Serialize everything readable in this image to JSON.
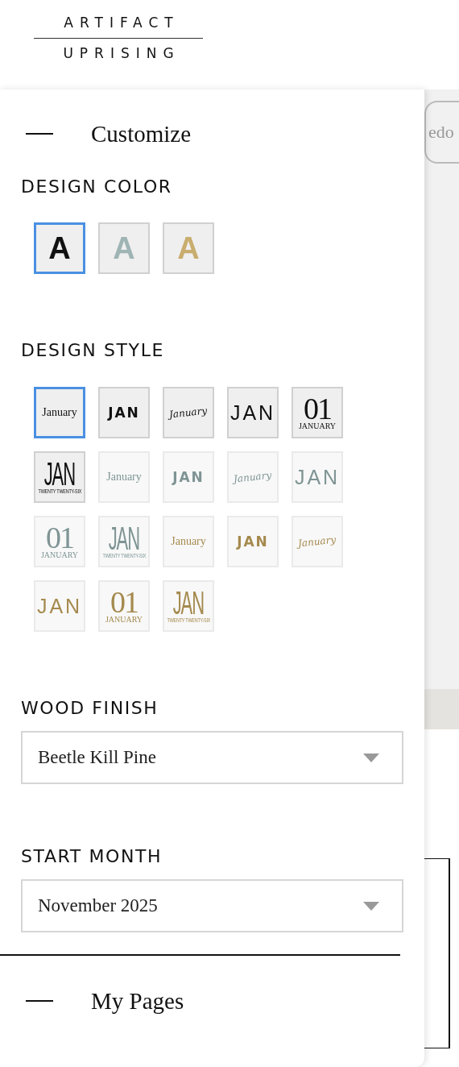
{
  "logo": {
    "top": "ARTIFACT",
    "bottom": "UPRISING"
  },
  "toolbar": {
    "redo_label": "edo"
  },
  "customize": {
    "title": "Customize",
    "expanded": true,
    "design_color": {
      "heading": "DESIGN COLOR",
      "options": [
        {
          "letter": "A",
          "color": "#111111",
          "selected": true
        },
        {
          "letter": "A",
          "color": "#9fb4b4",
          "selected": false
        },
        {
          "letter": "A",
          "color": "#c9ad6e",
          "selected": false
        }
      ]
    },
    "design_style": {
      "heading": "DESIGN STYLE",
      "options": [
        {
          "kind": "serif",
          "text": "January",
          "color": "#111111",
          "available": true,
          "selected": true
        },
        {
          "kind": "bold",
          "text": "JAN",
          "color": "#111111",
          "available": true,
          "selected": false
        },
        {
          "kind": "script",
          "text": "January",
          "color": "#111111",
          "available": true,
          "selected": false
        },
        {
          "kind": "thin",
          "text": "JAN",
          "color": "#111111",
          "available": true,
          "selected": false
        },
        {
          "kind": "numeral",
          "text": "01",
          "subtext": "JANUARY",
          "color": "#111111",
          "available": true,
          "selected": false
        },
        {
          "kind": "tall",
          "text": "JAN",
          "subtext": "TWENTY TWENTY-SIX",
          "color": "#111111",
          "available": true,
          "selected": false
        },
        {
          "kind": "serif",
          "text": "January",
          "color": "#7f9494",
          "available": false,
          "selected": false
        },
        {
          "kind": "bold",
          "text": "JAN",
          "color": "#7f9494",
          "available": false,
          "selected": false
        },
        {
          "kind": "script",
          "text": "January",
          "color": "#7f9494",
          "available": false,
          "selected": false
        },
        {
          "kind": "thin",
          "text": "JAN",
          "color": "#7f9494",
          "available": false,
          "selected": false
        },
        {
          "kind": "numeral",
          "text": "01",
          "subtext": "JANUARY",
          "color": "#7f9494",
          "available": false,
          "selected": false
        },
        {
          "kind": "tall",
          "text": "JAN",
          "subtext": "TWENTY TWENTY-SIX",
          "color": "#7f9494",
          "available": false,
          "selected": false
        },
        {
          "kind": "serif",
          "text": "January",
          "color": "#a58a4e",
          "available": false,
          "selected": false
        },
        {
          "kind": "bold",
          "text": "JAN",
          "color": "#a58a4e",
          "available": false,
          "selected": false
        },
        {
          "kind": "script",
          "text": "January",
          "color": "#a58a4e",
          "available": false,
          "selected": false
        },
        {
          "kind": "thin",
          "text": "JAN",
          "color": "#a58a4e",
          "available": false,
          "selected": false
        },
        {
          "kind": "numeral",
          "text": "01",
          "subtext": "JANUARY",
          "color": "#a58a4e",
          "available": false,
          "selected": false
        },
        {
          "kind": "tall",
          "text": "JAN",
          "subtext": "TWENTY TWENTY-SIX",
          "color": "#a58a4e",
          "available": false,
          "selected": false
        }
      ]
    },
    "wood_finish": {
      "heading": "WOOD FINISH",
      "value": "Beetle Kill Pine"
    },
    "start_month": {
      "heading": "START MONTH",
      "value": "November 2025"
    }
  },
  "my_pages": {
    "title": "My Pages",
    "expanded": false
  }
}
